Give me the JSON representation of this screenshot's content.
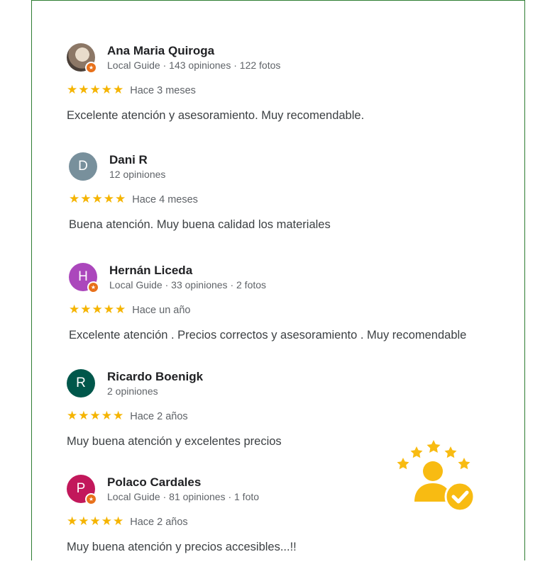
{
  "reviews": [
    {
      "name": "Ana Maria Quiroga",
      "meta": "Local Guide · 143 opiniones · 122 fotos",
      "date": "Hace 3 meses",
      "text": "Excelente atención y asesoramiento. Muy recomendable.",
      "initial": "",
      "avatar_color": "#7a6a5c",
      "local_guide": true,
      "rating": 5
    },
    {
      "name": "Dani R",
      "meta": "12 opiniones",
      "date": "Hace 4 meses",
      "text": "Buena atención. Muy buena calidad los materiales",
      "initial": "D",
      "avatar_color": "#78909c",
      "local_guide": false,
      "rating": 5
    },
    {
      "name": "Hernán Liceda",
      "meta": "Local Guide · 33 opiniones · 2 fotos",
      "date": "Hace un año",
      "text": "Excelente atención . Precios correctos y asesoramiento . Muy recomendable",
      "initial": "H",
      "avatar_color": "#ab47bc",
      "local_guide": true,
      "rating": 5
    },
    {
      "name": "Ricardo Boenigk",
      "meta": "2 opiniones",
      "date": "Hace 2 años",
      "text": "Muy buena atención y excelentes precios",
      "initial": "R",
      "avatar_color": "#00574b",
      "local_guide": false,
      "rating": 5
    },
    {
      "name": "Polaco Cardales",
      "meta": "Local Guide · 81 opiniones · 1 foto",
      "date": "Hace 2 años",
      "text": "Muy buena atención y precios accesibles...!!",
      "initial": "P",
      "avatar_color": "#c2185b",
      "local_guide": true,
      "rating": 5
    }
  ],
  "colors": {
    "star": "#f5b400",
    "local_guide_badge": "#e8711b",
    "frame_border": "#2e7d32",
    "graphic_accent": "#f8bb12"
  },
  "icons": {
    "star": "star-icon",
    "badge": "local-guide-badge-icon",
    "graphic": "customer-rating-icon"
  }
}
